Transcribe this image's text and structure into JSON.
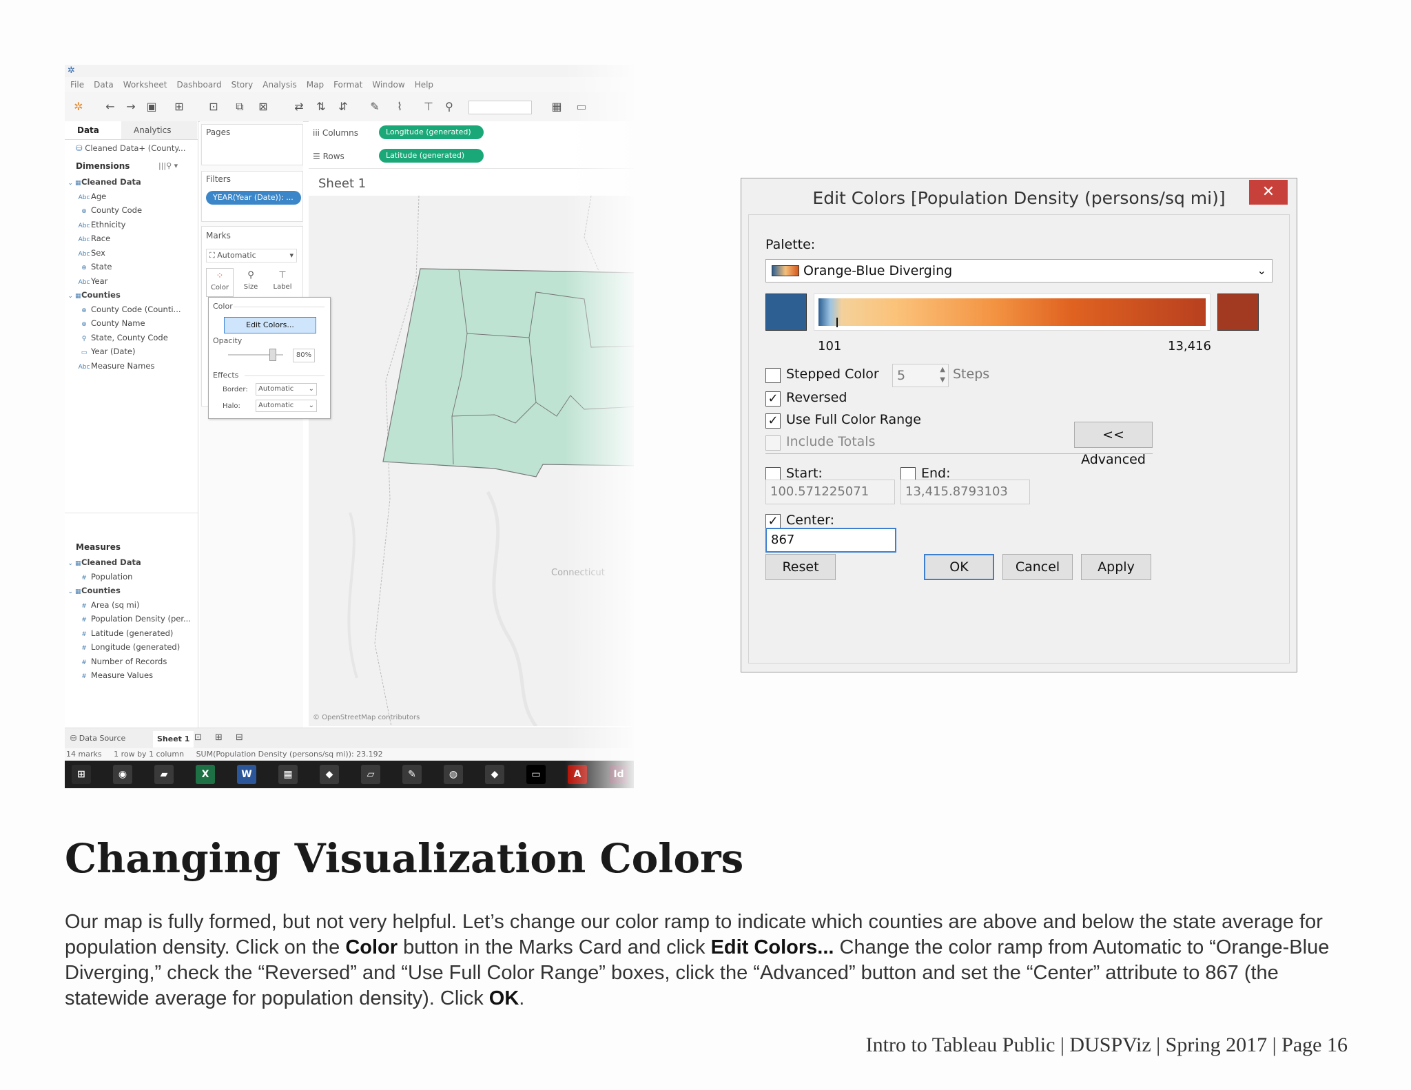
{
  "tableau": {
    "menu": [
      "File",
      "Data",
      "Worksheet",
      "Dashboard",
      "Story",
      "Analysis",
      "Map",
      "Format",
      "Window",
      "Help"
    ],
    "data_tab": "Data",
    "analytics_tab": "Analytics",
    "datasource": "Cleaned Data+ (County...",
    "dimensions_header": "Dimensions",
    "dimensions": [
      {
        "label": "Cleaned Data",
        "group": true,
        "icon": "table-icon"
      },
      {
        "label": "Age",
        "icon": "abc-icon"
      },
      {
        "label": "County Code",
        "icon": "globe-icon"
      },
      {
        "label": "Ethnicity",
        "icon": "abc-icon"
      },
      {
        "label": "Race",
        "icon": "abc-icon"
      },
      {
        "label": "Sex",
        "icon": "abc-icon"
      },
      {
        "label": "State",
        "icon": "globe-icon"
      },
      {
        "label": "Year",
        "icon": "abc-icon"
      },
      {
        "label": "Counties",
        "group": true,
        "icon": "table-icon"
      },
      {
        "label": "County Code (Counti...",
        "icon": "globe-icon"
      },
      {
        "label": "County Name",
        "icon": "globe-icon"
      },
      {
        "label": "State, County Code",
        "icon": "hierarchy-icon"
      },
      {
        "label": "Year (Date)",
        "icon": "calendar-icon"
      },
      {
        "label": "Measure Names",
        "icon": "abc-icon"
      }
    ],
    "measures_header": "Measures",
    "measures": [
      {
        "label": "Cleaned Data",
        "group": true
      },
      {
        "label": "Population"
      },
      {
        "label": "Counties",
        "group": true
      },
      {
        "label": "Area (sq mi)"
      },
      {
        "label": "Population Density (per..."
      },
      {
        "label": "Latitude (generated)"
      },
      {
        "label": "Longitude (generated)"
      },
      {
        "label": "Number of Records"
      },
      {
        "label": "Measure Values"
      }
    ],
    "pages_label": "Pages",
    "filters_label": "Filters",
    "filter_pill": "YEAR(Year (Date)): ...",
    "marks_label": "Marks",
    "marks_type": "Automatic",
    "marks_buttons": [
      "Color",
      "Size",
      "Label"
    ],
    "columns_label": "Columns",
    "rows_label": "Rows",
    "columns_pill": "Longitude (generated)",
    "rows_pill": "Latitude (generated)",
    "sheet_title": "Sheet 1",
    "map_label": "Connecticut",
    "map_credit": "© OpenStreetMap contributors",
    "color_popup": {
      "color_label": "Color",
      "edit_button": "Edit Colors...",
      "opacity_label": "Opacity",
      "opacity_value": "80%",
      "effects_label": "Effects",
      "border_label": "Border:",
      "border_value": "Automatic",
      "halo_label": "Halo:",
      "halo_value": "Automatic"
    },
    "bottom_tabs": [
      "Data Source",
      "Sheet 1"
    ],
    "status": [
      "14 marks",
      "1 row by 1 column",
      "SUM(Population Density (persons/sq mi)): 23.192"
    ],
    "taskbar_icons": [
      "windows-icon",
      "chrome-icon",
      "folder-icon",
      "excel-icon",
      "word-icon",
      "calculator-icon",
      "app-icon",
      "sticky-notes-icon",
      "paint-icon",
      "globe-icon",
      "app-icon",
      "terminal-icon",
      "acrobat-icon",
      "indesign-icon"
    ]
  },
  "dialog": {
    "title": "Edit Colors [Population Density (persons/sq mi)]",
    "palette_label": "Palette:",
    "palette_value": "Orange-Blue Diverging",
    "min_value": "101",
    "max_value": "13,416",
    "stepped_label": "Stepped Color",
    "steps_value": "5",
    "steps_label": "Steps",
    "reversed_label": "Reversed",
    "full_range_label": "Use Full Color Range",
    "include_totals_label": "Include Totals",
    "advanced_button": "<< Advanced",
    "start_label": "Start:",
    "end_label": "End:",
    "start_value": "100.571225071",
    "end_value": "13,415.8793103",
    "center_label": "Center:",
    "center_value": "867",
    "reset_button": "Reset",
    "ok_button": "OK",
    "cancel_button": "Cancel",
    "apply_button": "Apply",
    "checks": {
      "stepped": false,
      "reversed": true,
      "full_range": true,
      "include_totals": false,
      "start": false,
      "end": false,
      "center": true
    },
    "colors": {
      "low": "#2d5f93",
      "high": "#a23a22"
    }
  },
  "doc": {
    "title": "Changing Visualization Colors",
    "p1": "Our map is fully formed, but not very helpful. Let’s change our color ramp to indicate which counties are above and below the state average for population density. Click on the ",
    "b1": "Color",
    "p2": " button in the Marks Card and click ",
    "b2": "Edit Colors...",
    "p3": " Change the color ramp from Automatic to “Orange-Blue Diverging,” check the “Reversed” and “Use Full Color Range” boxes, click the “Advanced” button and set the “Center” attribute to 867 (the statewide average for population density). Click ",
    "b3": "OK",
    "p4": ".",
    "footer": "Intro to Tableau Public | DUSPViz | Spring 2017 | Page 16"
  }
}
